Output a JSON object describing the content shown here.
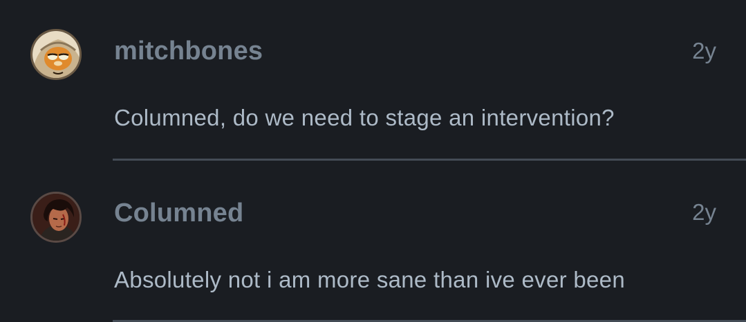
{
  "comments": [
    {
      "username": "mitchbones",
      "timestamp": "2y",
      "text": "Columned, do we need to stage an intervention?",
      "avatar": {
        "icon": "cartoon-cat-avatar",
        "colors": {
          "bg": "#e8dcc4",
          "fur": "#e08a2c",
          "blanket": "#c9b38e"
        }
      }
    },
    {
      "username": "Columned",
      "timestamp": "2y",
      "text": "Absolutely not i am more sane than ive ever been",
      "avatar": {
        "icon": "dark-portrait-avatar",
        "colors": {
          "bg": "#3a1e18",
          "face": "#b56a4a",
          "hair": "#1a0d0a"
        }
      }
    }
  ],
  "theme": {
    "background": "#1a1d22",
    "username_color": "#768391",
    "text_color": "#adbac7",
    "divider_color": "#444c56"
  }
}
